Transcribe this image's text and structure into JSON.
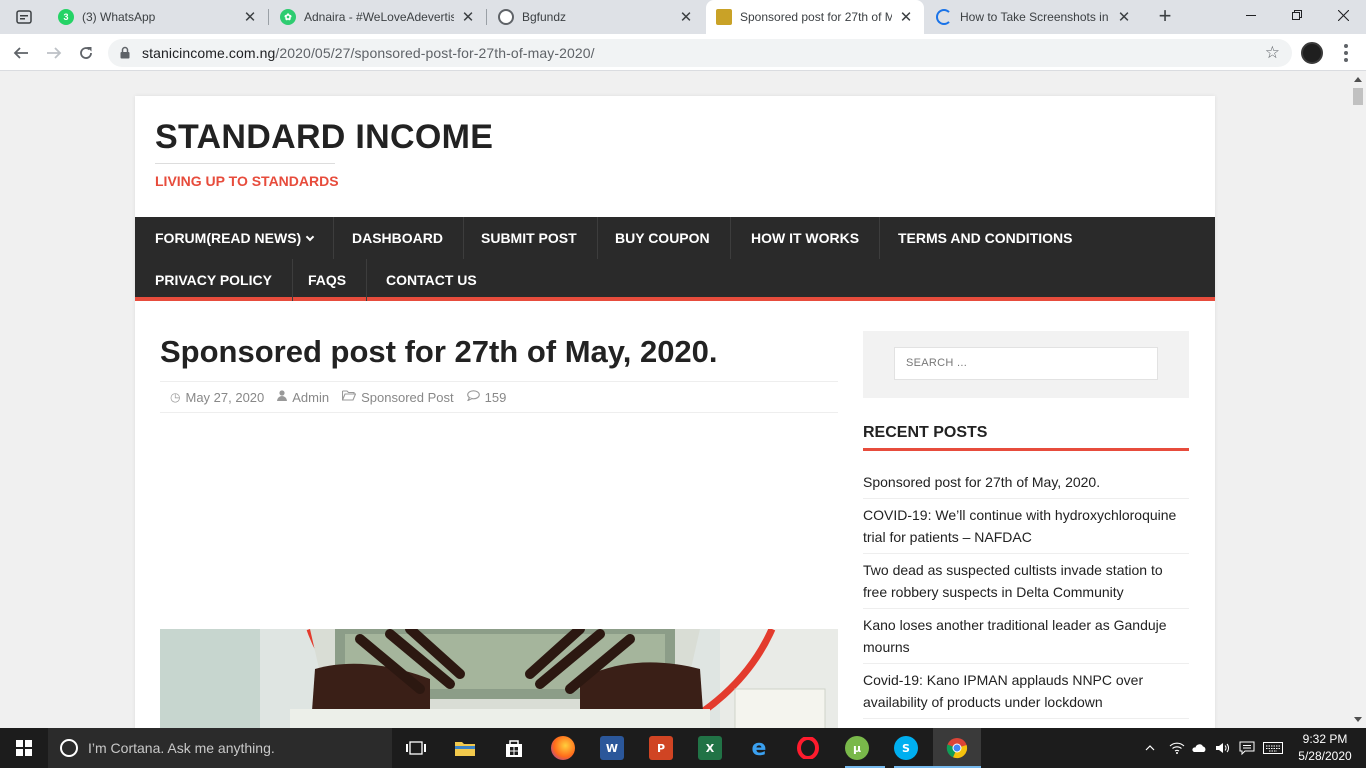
{
  "browser": {
    "tabs": [
      {
        "title": "(3) WhatsApp",
        "favicon_color": "#25d366",
        "badge": "3"
      },
      {
        "title": "Adnaira - #WeLoveAdevertisi",
        "favicon_color": "#2ecc71"
      },
      {
        "title": "Bgfundz",
        "favicon_color": "#5f6368"
      },
      {
        "title": "Sponsored post for 27th of M",
        "favicon_color": "#c9a227"
      },
      {
        "title": "How to Take Screenshots in W",
        "favicon_color": "#1a73e8"
      }
    ],
    "url_host": "stanicincome.com.ng",
    "url_path": "/2020/05/27/sponsored-post-for-27th-of-may-2020/",
    "icons": {
      "back": "back-arrow-icon",
      "forward": "forward-arrow-icon",
      "reload": "reload-icon",
      "lock": "lock-icon",
      "bookmark": "star-icon",
      "menu": "kebab-menu-icon"
    }
  },
  "site": {
    "title": "STANDARD INCOME",
    "tagline": "LIVING UP TO STANDARDS",
    "accent": "#e74c3c",
    "nav": [
      {
        "label": "FORUM(READ NEWS)",
        "has_dropdown": true
      },
      {
        "label": "DASHBOARD"
      },
      {
        "label": "SUBMIT POST"
      },
      {
        "label": "BUY COUPON"
      },
      {
        "label": "HOW IT WORKS"
      },
      {
        "label": "TERMS AND CONDITIONS"
      },
      {
        "label": "PRIVACY POLICY"
      },
      {
        "label": "FAQS"
      },
      {
        "label": "CONTACT US"
      }
    ]
  },
  "post": {
    "title": "Sponsored post for 27th of May, 2020.",
    "date": "May 27, 2020",
    "author": "Admin",
    "category": "Sponsored Post",
    "comments": "159"
  },
  "sidebar": {
    "search_placeholder": "SEARCH ...",
    "recent_title": "RECENT POSTS",
    "recent_posts": [
      "Sponsored post for 27th of May, 2020.",
      "COVID-19: We’ll continue with hydroxychloroquine trial for patients – NAFDAC",
      "Two dead as suspected cultists invade station to free robbery suspects in Delta Community",
      "Kano loses another traditional leader as Ganduje mourns",
      "Covid-19: Kano IPMAN applauds NNPC over availability of products under lockdown"
    ]
  },
  "taskbar": {
    "cortana_text": "I’m Cortana. Ask me anything.",
    "time": "9:32 PM",
    "date": "5/28/2020",
    "apps": [
      "task-view",
      "file-explorer",
      "store",
      "firefox",
      "word",
      "powerpoint",
      "excel",
      "edge",
      "opera",
      "utorrent",
      "skype",
      "chrome"
    ]
  }
}
